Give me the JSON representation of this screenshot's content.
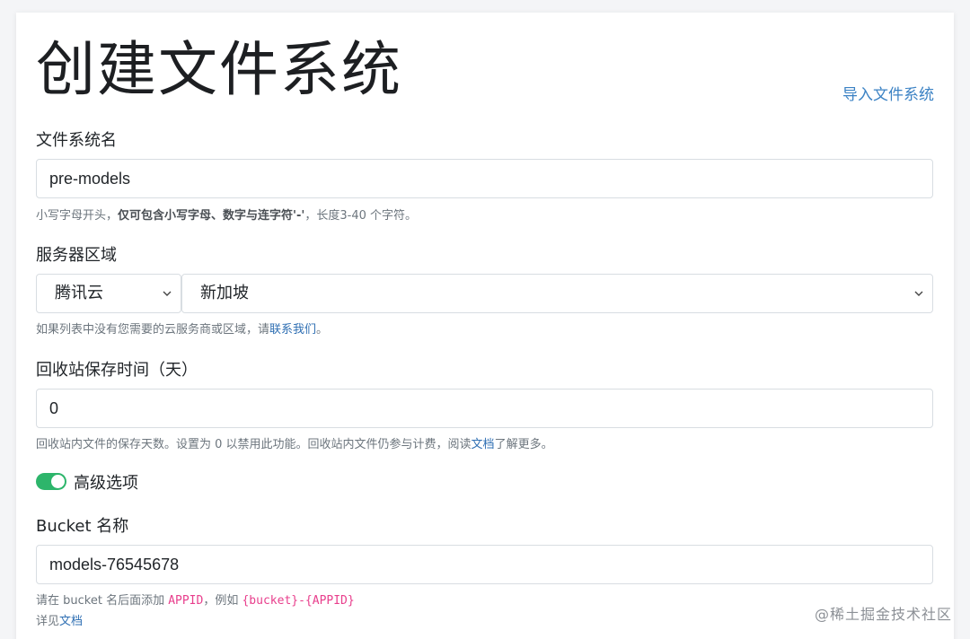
{
  "page": {
    "title": "创建文件系统",
    "import_link": "导入文件系统"
  },
  "fs_name": {
    "label": "文件系统名",
    "value": "pre-models",
    "help_prefix": "小写字母开头，",
    "help_bold": "仅可包含小写字母、数字与连字符'-'",
    "help_suffix": "，长度3-40 个字符。"
  },
  "region": {
    "label": "服务器区域",
    "provider": "腾讯云",
    "location": "新加坡",
    "help_prefix": "如果列表中没有您需要的云服务商或区域，请",
    "help_link": "联系我们",
    "help_suffix": "。"
  },
  "trash": {
    "label": "回收站保存时间（天）",
    "value": "0",
    "help_prefix": "回收站内文件的保存天数。设置为 0 以禁用此功能。回收站内文件仍参与计费，阅读",
    "help_link": "文档",
    "help_suffix": "了解更多。"
  },
  "advanced": {
    "label": "高级选项",
    "enabled": true,
    "accent_color": "#2db56b"
  },
  "bucket": {
    "label": "Bucket 名称",
    "value": "models-76545678",
    "help_prefix": "请在 bucket 名后面添加 ",
    "help_code1": "APPID",
    "help_mid": "，例如 ",
    "help_code2": "{bucket}-{APPID}",
    "help2_prefix": "详见",
    "help2_link": "文档"
  },
  "watermark": "@稀土掘金技术社区"
}
